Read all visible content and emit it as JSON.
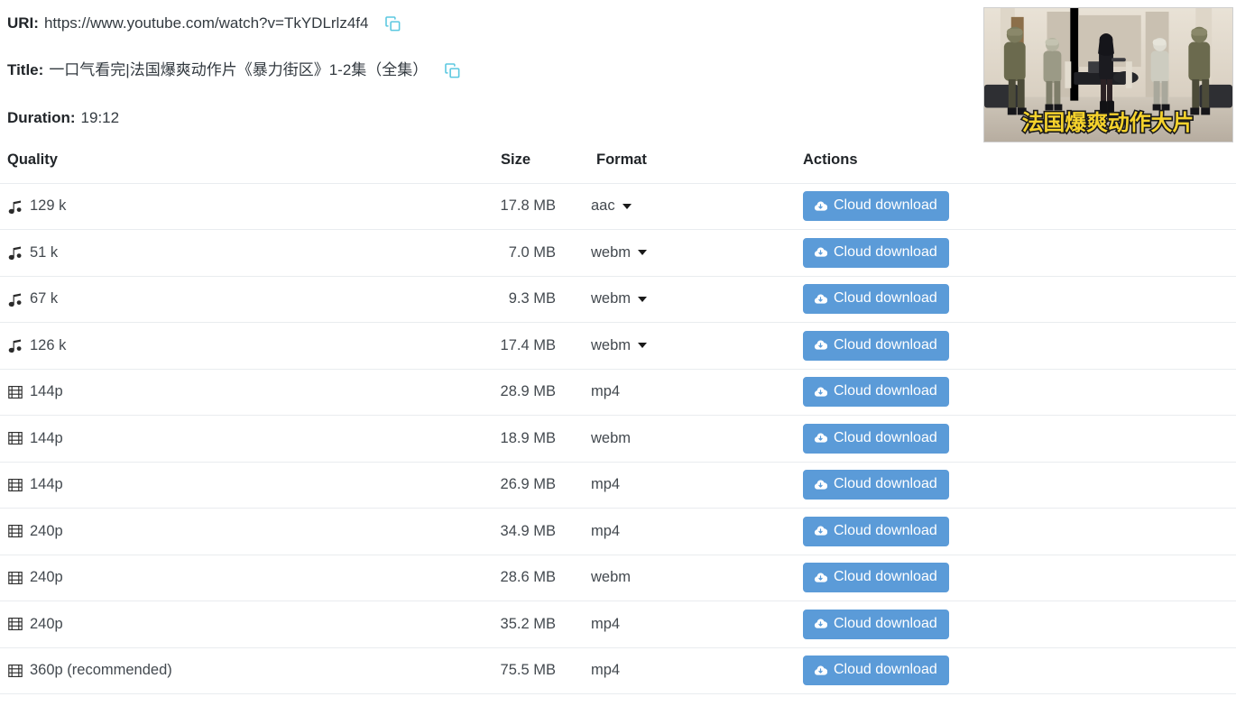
{
  "meta": {
    "uri_label": "URI:",
    "uri_value": "https://www.youtube.com/watch?v=TkYDLrlz4f4",
    "title_label": "Title:",
    "title_value": "一口气看完|法国爆爽动作片《暴力街区》1-2集（全集）",
    "duration_label": "Duration:",
    "duration_value": "19:12",
    "copy_icon": "copy-icon"
  },
  "thumbnail": {
    "overlay_text": "法国爆爽动作大片",
    "alt": "video-thumbnail"
  },
  "table": {
    "headers": {
      "quality": "Quality",
      "size": "Size",
      "format": "Format",
      "actions": "Actions"
    },
    "download_label": "Cloud download",
    "rows": [
      {
        "kind": "audio",
        "icon": "music-note-icon",
        "quality": "129 k",
        "size": "17.8 MB",
        "format": "aac",
        "has_caret": true,
        "action": "Cloud download"
      },
      {
        "kind": "audio",
        "icon": "music-note-icon",
        "quality": "51 k",
        "size": "7.0 MB",
        "format": "webm",
        "has_caret": true,
        "action": "Cloud download"
      },
      {
        "kind": "audio",
        "icon": "music-note-icon",
        "quality": "67 k",
        "size": "9.3 MB",
        "format": "webm",
        "has_caret": true,
        "action": "Cloud download"
      },
      {
        "kind": "audio",
        "icon": "music-note-icon",
        "quality": "126 k",
        "size": "17.4 MB",
        "format": "webm",
        "has_caret": true,
        "action": "Cloud download"
      },
      {
        "kind": "video",
        "icon": "film-icon",
        "quality": "144p",
        "size": "28.9 MB",
        "format": "mp4",
        "has_caret": false,
        "action": "Cloud download"
      },
      {
        "kind": "video",
        "icon": "film-icon",
        "quality": "144p",
        "size": "18.9 MB",
        "format": "webm",
        "has_caret": false,
        "action": "Cloud download"
      },
      {
        "kind": "video",
        "icon": "film-icon",
        "quality": "144p",
        "size": "26.9 MB",
        "format": "mp4",
        "has_caret": false,
        "action": "Cloud download"
      },
      {
        "kind": "video",
        "icon": "film-icon",
        "quality": "240p",
        "size": "34.9 MB",
        "format": "mp4",
        "has_caret": false,
        "action": "Cloud download"
      },
      {
        "kind": "video",
        "icon": "film-icon",
        "quality": "240p",
        "size": "28.6 MB",
        "format": "webm",
        "has_caret": false,
        "action": "Cloud download"
      },
      {
        "kind": "video",
        "icon": "film-icon",
        "quality": "240p",
        "size": "35.2 MB",
        "format": "mp4",
        "has_caret": false,
        "action": "Cloud download"
      },
      {
        "kind": "video",
        "icon": "film-icon",
        "quality": "360p (recommended)",
        "size": "75.5 MB",
        "format": "mp4",
        "has_caret": false,
        "action": "Cloud download"
      }
    ]
  },
  "colors": {
    "button_blue": "#5b9bd8",
    "copy_icon_blue": "#5bc8e0",
    "divider": "#e9ecef",
    "text": "#43494f",
    "heading": "#212529"
  }
}
